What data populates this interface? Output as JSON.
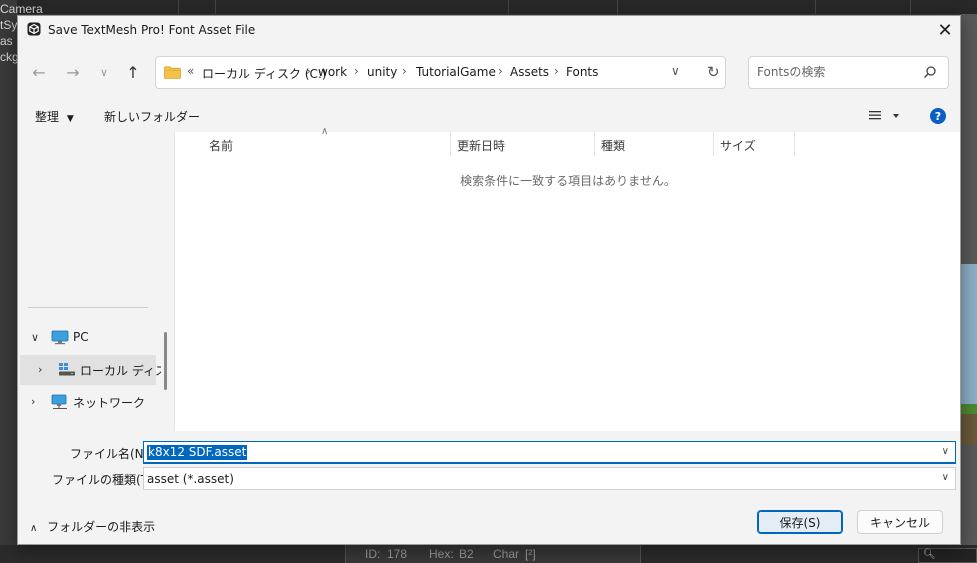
{
  "background": {
    "hierarchy_lines": [
      "Camera",
      "tSy",
      "as",
      "ckg"
    ],
    "status": {
      "id_label": "ID:",
      "id_value": "178",
      "hex_label": "Hex:",
      "hex_value": "B2",
      "char_label": "Char",
      "char_value": "[²]"
    }
  },
  "dialog": {
    "title": "Save TextMesh Pro! Font Asset File",
    "address": {
      "overflow": "«",
      "segments": [
        "ローカル ディスク (C:)",
        "work",
        "unity",
        "TutorialGame",
        "Assets",
        "Fonts"
      ]
    },
    "search": {
      "placeholder": "Fontsの検索"
    },
    "toolbar": {
      "organize_label": "整理",
      "new_folder_label": "新しいフォルダー"
    },
    "nav_pane": {
      "items": [
        {
          "label": "PC"
        },
        {
          "label": "ローカル ディスク"
        },
        {
          "label": "ネットワーク"
        }
      ]
    },
    "columns": [
      "名前",
      "更新日時",
      "種類",
      "サイズ"
    ],
    "empty_message": "検索条件に一致する項目はありません。",
    "filename": {
      "label": "ファイル名(N):",
      "value": "k8x12 SDF.asset"
    },
    "filetype": {
      "label": "ファイルの種類(T):",
      "value": "asset (*.asset)"
    },
    "hide_folders_label": "フォルダーの非表示",
    "save_label": "保存(S)",
    "cancel_label": "キャンセル"
  },
  "colors": {
    "accent": "#0067c0",
    "help": "#0a5fc5",
    "folder": "#f2c14e"
  }
}
